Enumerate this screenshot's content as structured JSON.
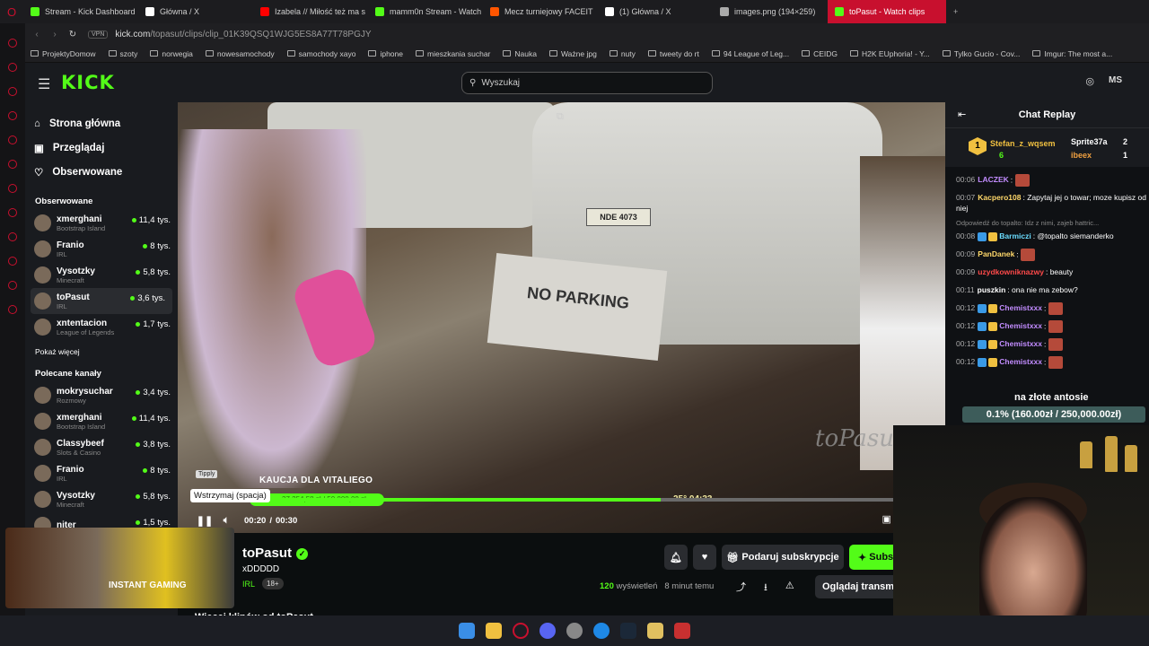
{
  "tabs": [
    {
      "title": "Stream - Kick Dashboard",
      "color": "#53fc18"
    },
    {
      "title": "Główna / X",
      "color": "#ffffff"
    },
    {
      "title": "Izabela // Miłość też ma s",
      "color": "#ff0000"
    },
    {
      "title": "mamm0n Stream - Watch",
      "color": "#53fc18"
    },
    {
      "title": "Mecz turniejowy FACEIT",
      "color": "#ff5500"
    },
    {
      "title": "(1) Główna / X",
      "color": "#ffffff"
    },
    {
      "title": "images.png (194×259)",
      "color": "#aaaaaa"
    },
    {
      "title": "toPasut - Watch clips",
      "color": "#53fc18"
    }
  ],
  "address": {
    "vpn": "VPN",
    "url_host": "kick.com",
    "url_path": "/topasut/clips/clip_01K39QSQ1WJG5ES8A77T78PGJY"
  },
  "bookmarks": [
    "ProjektyDomow",
    "szoty",
    "norwegia",
    "nowesamochody",
    "samochody xayo",
    "iphone",
    "mieszkania suchar",
    "Nauka",
    "Ważne jpg",
    "nuty",
    "tweety do rt",
    "94 League of Leg...",
    "CEIDG",
    "H2K EUphoria! - Y...",
    "Tylko Gucio - Cov...",
    "Imgur: The most a..."
  ],
  "header": {
    "logo": "KICK",
    "search_placeholder": "Wyszukaj",
    "user_initials": "MS"
  },
  "sidebar": {
    "nav": [
      {
        "label": "Strona główna",
        "icon": "home-icon"
      },
      {
        "label": "Przeglądaj",
        "icon": "browse-icon"
      },
      {
        "label": "Obserwowane",
        "icon": "heart-icon"
      }
    ],
    "followed_title": "Obserwowane",
    "followed": [
      {
        "name": "xmerghani",
        "cat": "Bootstrap Island",
        "viewers": "11,4 tys."
      },
      {
        "name": "Franio",
        "cat": "IRL",
        "viewers": "8 tys."
      },
      {
        "name": "Vysotzky",
        "cat": "Minecraft",
        "viewers": "5,8 tys."
      },
      {
        "name": "toPasut",
        "cat": "IRL",
        "viewers": "3,6 tys."
      },
      {
        "name": "xntentacion",
        "cat": "League of Legends",
        "viewers": "1,7 tys."
      }
    ],
    "show_more": "Pokaż więcej",
    "recommended_title": "Polecane kanały",
    "recommended": [
      {
        "name": "mokrysuchar",
        "cat": "Rozmowy",
        "viewers": "3,4 tys."
      },
      {
        "name": "xmerghani",
        "cat": "Bootstrap Island",
        "viewers": "11,4 tys."
      },
      {
        "name": "Classybeef",
        "cat": "Slots & Casino",
        "viewers": "3,8 tys."
      },
      {
        "name": "Franio",
        "cat": "IRL",
        "viewers": "8 tys."
      },
      {
        "name": "Vysotzky",
        "cat": "Minecraft",
        "viewers": "5,8 tys."
      },
      {
        "name": "niter",
        "cat": "",
        "viewers": "1,5 tys."
      }
    ]
  },
  "video": {
    "overlay_title": "KAUCJA DLA VITALIEGO",
    "tipply": "Tipply",
    "tooltip": "Wstrzymaj (spacja)",
    "donation": "37 254,58 zł / 50 000,00 zł",
    "stream_timer": "25° 04:33",
    "watermark": "toPasut",
    "plate": "NDE 4073",
    "sign": "NO PARKING",
    "current_time": "00:20",
    "duration": "00:30",
    "progress": 0.667,
    "time_sep": "/"
  },
  "channel": {
    "name": "toPasut",
    "subtitle": "xDDDDD",
    "category": "IRL",
    "age": "18+",
    "gift_label": "Podaruj subskrypcje",
    "sub_label": "Subs",
    "views": "120",
    "views_label": "wyświetleń",
    "time_ago": "8 minut temu",
    "watch_label": "Oglądaj transm",
    "more_clips": "Więcej klipów od toPasut"
  },
  "ad": {
    "text": "INSTANT GAMING"
  },
  "chat": {
    "title": "Chat Replay",
    "gifters": [
      {
        "rank": "1",
        "name": "Stefan_z_wqsem",
        "count": "6"
      },
      {
        "name": "Sprite37a",
        "count": "2"
      },
      {
        "name": "ibeex",
        "count": "1"
      }
    ],
    "messages": [
      {
        "t": "00:06",
        "u": "LACZEK",
        "c": "#c28cff",
        "msg": "",
        "emote": true
      },
      {
        "t": "00:07",
        "u": "Kacpero108",
        "c": "#ffd86a",
        "msg": "Zapytaj jej o towar; moze kupisz od niej"
      },
      {
        "reply": "Odpowiedź do topalto: Idz z nimi, zajeb hattric..."
      },
      {
        "t": "00:08",
        "u": "Barmiczi",
        "c": "#6adcff",
        "msg": "@topalto siemanderko"
      },
      {
        "t": "00:09",
        "u": "PanDanek",
        "c": "#ffd86a",
        "msg": "",
        "emote": true
      },
      {
        "t": "00:09",
        "u": "uzydkowniknazwy",
        "c": "#ff4a4a",
        "msg": "beauty"
      },
      {
        "t": "00:11",
        "u": "puszkin",
        "c": "#ffffff",
        "msg": "ona nie ma zebow?"
      },
      {
        "t": "00:12",
        "u": "Chemistxxx",
        "c": "#c28cff",
        "msg": "",
        "emote": true
      },
      {
        "t": "00:12",
        "u": "Chemistxxx",
        "c": "#c28cff",
        "msg": "",
        "emote": true
      },
      {
        "t": "00:12",
        "u": "Chemistxxx",
        "c": "#c28cff",
        "msg": "",
        "emote": true
      },
      {
        "t": "00:12",
        "u": "Chemistxxx",
        "c": "#c28cff",
        "msg": "",
        "emote": true
      },
      {
        "t": "00:13",
        "u": "LACZEK",
        "c": "#c28cff",
        "msg": "na złote antosie"
      }
    ],
    "goal": "0.1% (160.00zł / 250,000.00zł)"
  },
  "colors": {
    "accent": "#53fc18",
    "opera": "#c8102e"
  }
}
